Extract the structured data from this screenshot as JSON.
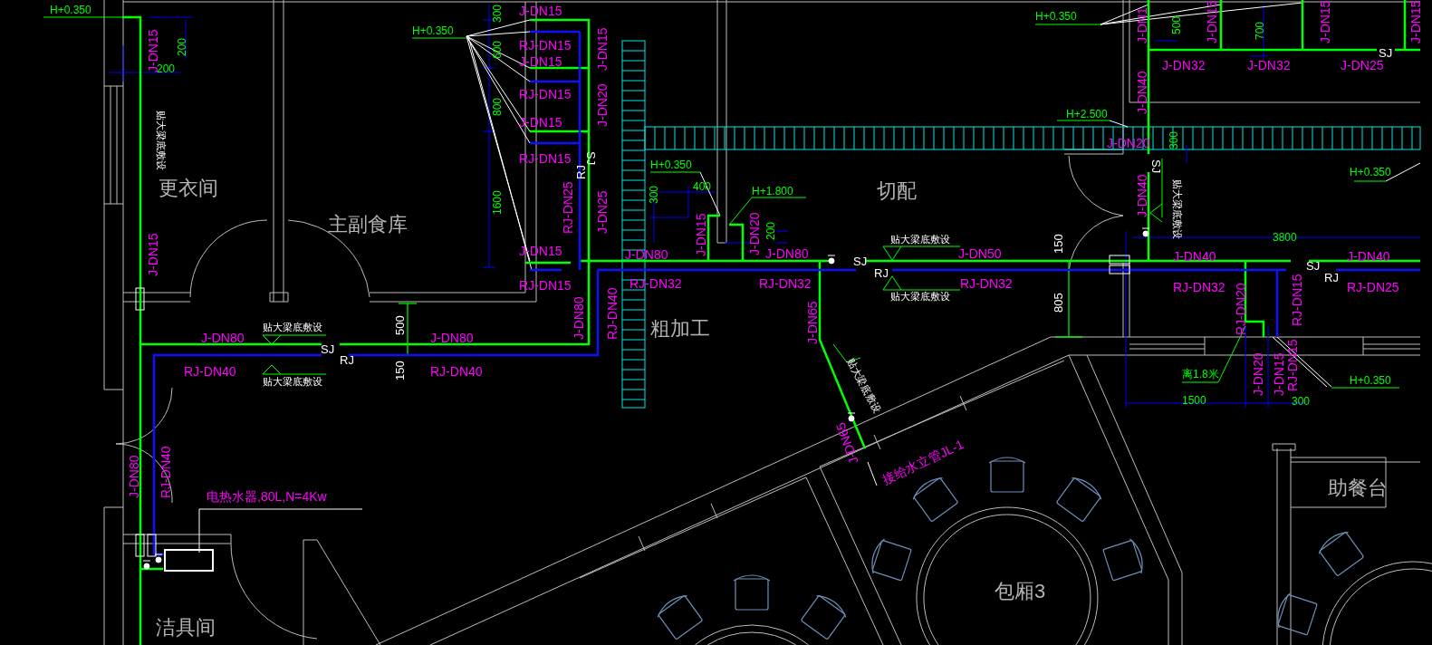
{
  "drawing": {
    "labels": [
      {
        "text": "H+0.350",
        "kind": "elevation"
      },
      {
        "text": "J-DN15",
        "kind": "pipe"
      },
      {
        "text": "200",
        "kind": "dimension"
      },
      {
        "text": "200",
        "kind": "dimension"
      },
      {
        "text": "贴大梁底敷设",
        "kind": "note"
      },
      {
        "text": "更衣间",
        "kind": "room"
      },
      {
        "text": "J-DN15",
        "kind": "pipe"
      },
      {
        "text": "主副食库",
        "kind": "room"
      },
      {
        "text": "H+0.350",
        "kind": "elevation"
      },
      {
        "text": "300",
        "kind": "dimension"
      },
      {
        "text": "J-DN15",
        "kind": "pipe"
      },
      {
        "text": "RJ-DN15",
        "kind": "pipe"
      },
      {
        "text": "600",
        "kind": "dimension"
      },
      {
        "text": "J-DN15",
        "kind": "pipe"
      },
      {
        "text": "RJ-DN15",
        "kind": "pipe"
      },
      {
        "text": "800",
        "kind": "dimension"
      },
      {
        "text": "J-DN15",
        "kind": "pipe"
      },
      {
        "text": "RJ-DN15",
        "kind": "pipe"
      },
      {
        "text": "1600",
        "kind": "dimension"
      },
      {
        "text": "J-DN15",
        "kind": "pipe"
      },
      {
        "text": "RJ-DN15",
        "kind": "pipe"
      },
      {
        "text": "J-DN15",
        "kind": "pipe"
      },
      {
        "text": "J-DN20",
        "kind": "pipe"
      },
      {
        "text": "SJ",
        "kind": "tag"
      },
      {
        "text": "RJ",
        "kind": "tag"
      },
      {
        "text": "RJ-DN25",
        "kind": "pipe"
      },
      {
        "text": "J-DN25",
        "kind": "pipe"
      },
      {
        "text": "J-DN80",
        "kind": "pipe"
      },
      {
        "text": "RJ-DN40",
        "kind": "pipe"
      },
      {
        "text": "H+0.350",
        "kind": "elevation"
      },
      {
        "text": "400",
        "kind": "dimension"
      },
      {
        "text": "300",
        "kind": "dimension"
      },
      {
        "text": "J-DN80",
        "kind": "pipe"
      },
      {
        "text": "RJ-DN32",
        "kind": "pipe"
      },
      {
        "text": "J-DN15",
        "kind": "pipe"
      },
      {
        "text": "H+1.800",
        "kind": "elevation"
      },
      {
        "text": "J-DN20",
        "kind": "pipe"
      },
      {
        "text": "200",
        "kind": "dimension"
      },
      {
        "text": "J-DN80",
        "kind": "pipe"
      },
      {
        "text": "切配",
        "kind": "room"
      },
      {
        "text": "贴大梁底敷设",
        "kind": "note"
      },
      {
        "text": "SJ",
        "kind": "tag"
      },
      {
        "text": "RJ",
        "kind": "tag"
      },
      {
        "text": "贴大梁底敷设",
        "kind": "note"
      },
      {
        "text": "RJ-DN32",
        "kind": "pipe"
      },
      {
        "text": "J-DN50",
        "kind": "pipe"
      },
      {
        "text": "RJ-DN32",
        "kind": "pipe"
      },
      {
        "text": "J-DN65",
        "kind": "pipe"
      },
      {
        "text": "贴大梁底敷设",
        "kind": "note"
      },
      {
        "text": "J-DN65",
        "kind": "pipe"
      },
      {
        "text": "接给水立管JL-1",
        "kind": "pipe"
      },
      {
        "text": "150",
        "kind": "tag"
      },
      {
        "text": "805",
        "kind": "tag"
      },
      {
        "text": "H+0.350",
        "kind": "elevation"
      },
      {
        "text": "J-DN1",
        "kind": "pipe"
      },
      {
        "text": "500",
        "kind": "dimension"
      },
      {
        "text": "J-DN15",
        "kind": "pipe"
      },
      {
        "text": "700",
        "kind": "dimension"
      },
      {
        "text": "J-DN15",
        "kind": "pipe"
      },
      {
        "text": "J-DN15",
        "kind": "pipe"
      },
      {
        "text": "SJ",
        "kind": "tag"
      },
      {
        "text": "J-DN32",
        "kind": "pipe"
      },
      {
        "text": "J-DN32",
        "kind": "pipe"
      },
      {
        "text": "J-DN25",
        "kind": "pipe"
      },
      {
        "text": "J-DN40",
        "kind": "pipe"
      },
      {
        "text": "H+2.500",
        "kind": "elevation"
      },
      {
        "text": "J-DN20",
        "kind": "pipe"
      },
      {
        "text": "300",
        "kind": "dimension"
      },
      {
        "text": "SJ",
        "kind": "tag"
      },
      {
        "text": "J-DN40",
        "kind": "pipe"
      },
      {
        "text": "贴大梁底敷设",
        "kind": "note"
      },
      {
        "text": "H+0.350",
        "kind": "elevation"
      },
      {
        "text": "3800",
        "kind": "dimension"
      },
      {
        "text": "J-DN40",
        "kind": "pipe"
      },
      {
        "text": "J-DN40",
        "kind": "pipe"
      },
      {
        "text": "SJ",
        "kind": "tag"
      },
      {
        "text": "RJ",
        "kind": "tag"
      },
      {
        "text": "RJ-DN32",
        "kind": "pipe"
      },
      {
        "text": "RJ-DN25",
        "kind": "pipe"
      },
      {
        "text": "RJ-DN20",
        "kind": "pipe"
      },
      {
        "text": "RJ-DN15",
        "kind": "pipe"
      },
      {
        "text": "粗加工",
        "kind": "room"
      },
      {
        "text": "J-DN80",
        "kind": "pipe"
      },
      {
        "text": "贴大梁底敷设",
        "kind": "note"
      },
      {
        "text": "SJ",
        "kind": "tag"
      },
      {
        "text": "RJ",
        "kind": "tag"
      },
      {
        "text": "500",
        "kind": "tag"
      },
      {
        "text": "J-DN80",
        "kind": "pipe"
      },
      {
        "text": "RJ-DN40",
        "kind": "pipe"
      },
      {
        "text": "贴大梁底敷设",
        "kind": "note"
      },
      {
        "text": "150",
        "kind": "tag"
      },
      {
        "text": "RJ-DN40",
        "kind": "pipe"
      },
      {
        "text": "J-DN80",
        "kind": "pipe"
      },
      {
        "text": "RJ-DN40",
        "kind": "pipe"
      },
      {
        "text": "电热水器,80L,N=4Kw",
        "kind": "pipe"
      },
      {
        "text": "洁具间",
        "kind": "room"
      },
      {
        "text": "离1.8米",
        "kind": "elevation"
      },
      {
        "text": "J-DN20",
        "kind": "pipe"
      },
      {
        "text": "J-DN15",
        "kind": "pipe"
      },
      {
        "text": "RJ-DN15",
        "kind": "pipe"
      },
      {
        "text": "1500",
        "kind": "dimension"
      },
      {
        "text": "300",
        "kind": "dimension"
      },
      {
        "text": "H+0.350",
        "kind": "elevation"
      },
      {
        "text": "包厢3",
        "kind": "room"
      },
      {
        "text": "助餐台",
        "kind": "room"
      }
    ]
  }
}
